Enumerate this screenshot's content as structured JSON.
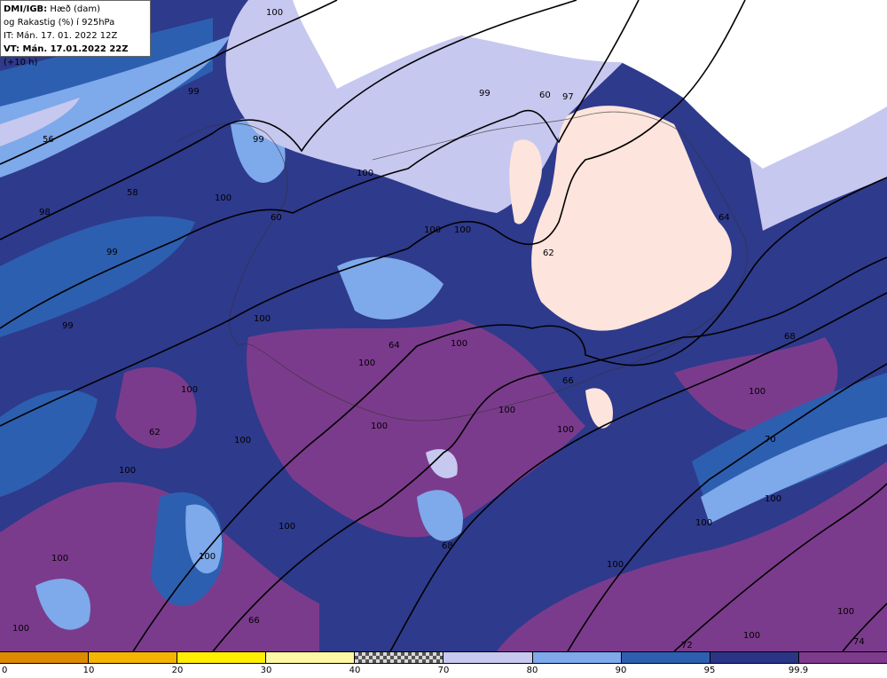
{
  "info": {
    "line1_bold": "DMI/IGB:",
    "line1_rest": " Hæð (dam)",
    "line2": "og Rakastig (%) í 925hPa",
    "line3": "IT: Mán. 17. 01. 2022 12Z",
    "line4_bold": "VT: Mán. 17.01.2022 22Z",
    "line4_rest": " (+10 h)"
  },
  "legend": {
    "swatches": [
      {
        "color": "#de8a00"
      },
      {
        "color": "#f5b400"
      },
      {
        "color": "#ffee00"
      },
      {
        "color": "#fcf8a4"
      },
      {
        "color": "checker"
      },
      {
        "color": "#c7c8ef"
      },
      {
        "color": "#7ea9ea"
      },
      {
        "color": "#2d5fb0"
      },
      {
        "color": "#2b3585"
      },
      {
        "color": "#7e3a8c"
      }
    ],
    "ticks": [
      "0",
      "10",
      "20",
      "30",
      "40",
      "70",
      "80",
      "90",
      "95",
      "99.9"
    ]
  },
  "contour_labels": [
    "56",
    "58",
    "60",
    "60",
    "62",
    "62",
    "64",
    "64",
    "66",
    "66",
    "68",
    "68",
    "70",
    "72",
    "74"
  ],
  "value_labels": [
    "100",
    "99",
    "99",
    "99",
    "99",
    "98",
    "97",
    "100",
    "100",
    "100",
    "100",
    "100",
    "100",
    "100",
    "100",
    "100",
    "100",
    "100",
    "100",
    "100",
    "100",
    "100",
    "100",
    "100",
    "100",
    "100",
    "100",
    "100",
    "99",
    "100",
    "100"
  ]
}
